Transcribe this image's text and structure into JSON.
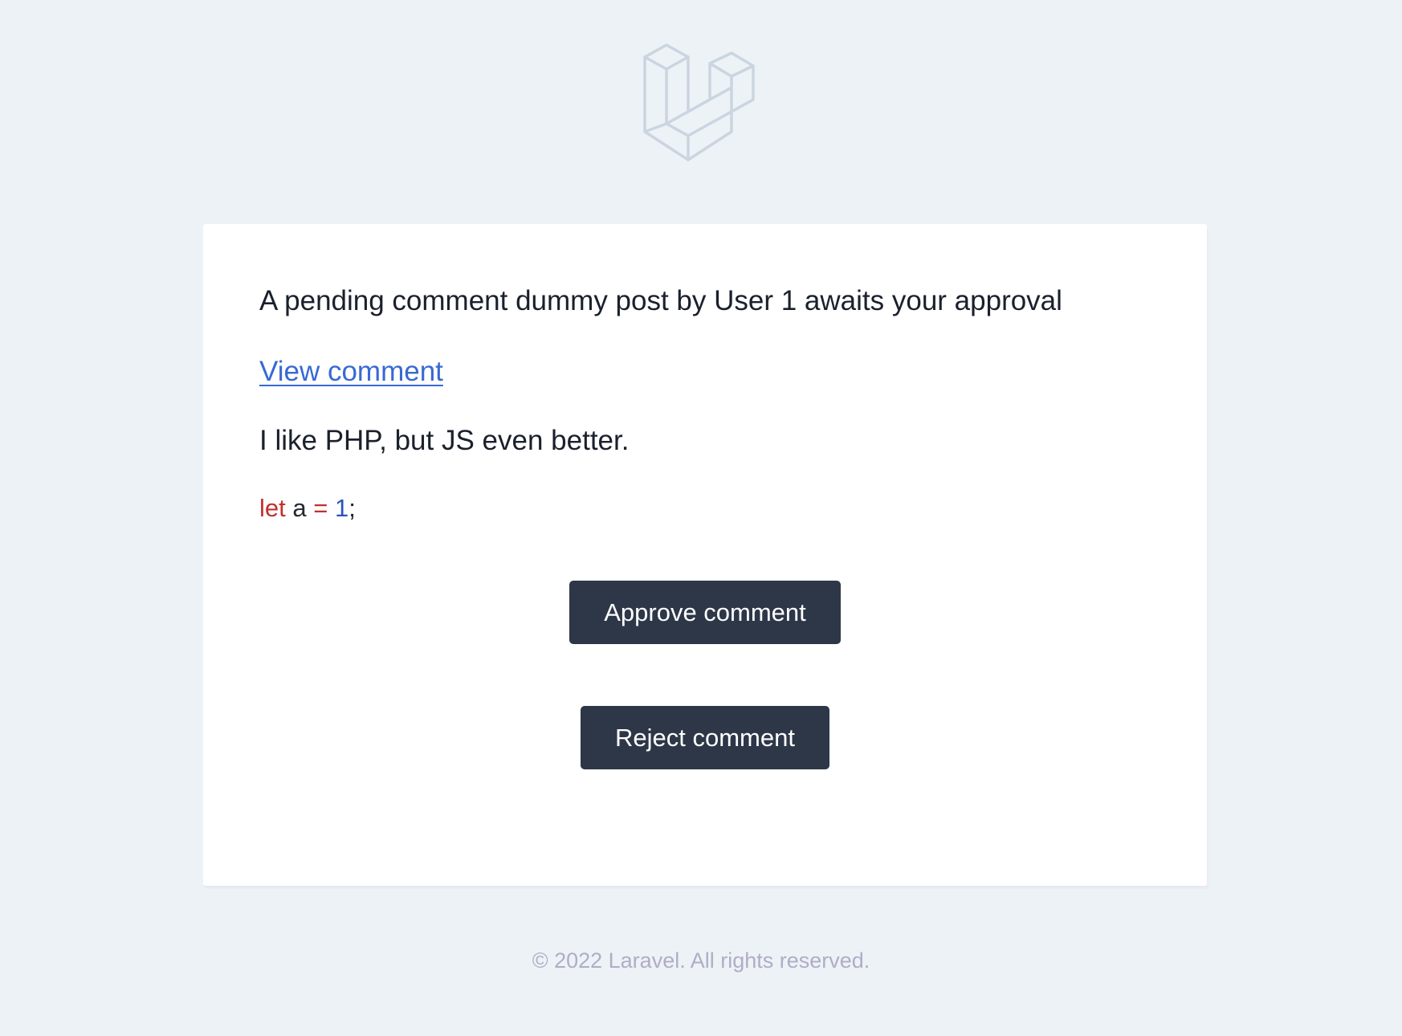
{
  "header": {
    "logo_icon": "laravel-logo-icon",
    "logo_color": "#cbd5e0"
  },
  "email": {
    "intro": "A pending comment dummy post by User 1 awaits your approval",
    "view_link_label": "View comment",
    "comment_text": "I like PHP, but JS even better.",
    "code": {
      "keyword": "let",
      "identifier": "a",
      "operator": "=",
      "number": "1",
      "terminator": ";"
    },
    "approve_label": "Approve comment",
    "reject_label": "Reject comment"
  },
  "footer": {
    "copyright": "© 2022 Laravel. All rights reserved."
  },
  "colors": {
    "page_background": "#edf2f7",
    "card_background": "#ffffff",
    "text": "#1a202c",
    "link": "#3869d4",
    "button": "#2d3748",
    "button_text": "#ffffff",
    "footer_text": "#b0adc5",
    "code_keyword": "#c0312d",
    "code_number": "#2b55b8"
  }
}
